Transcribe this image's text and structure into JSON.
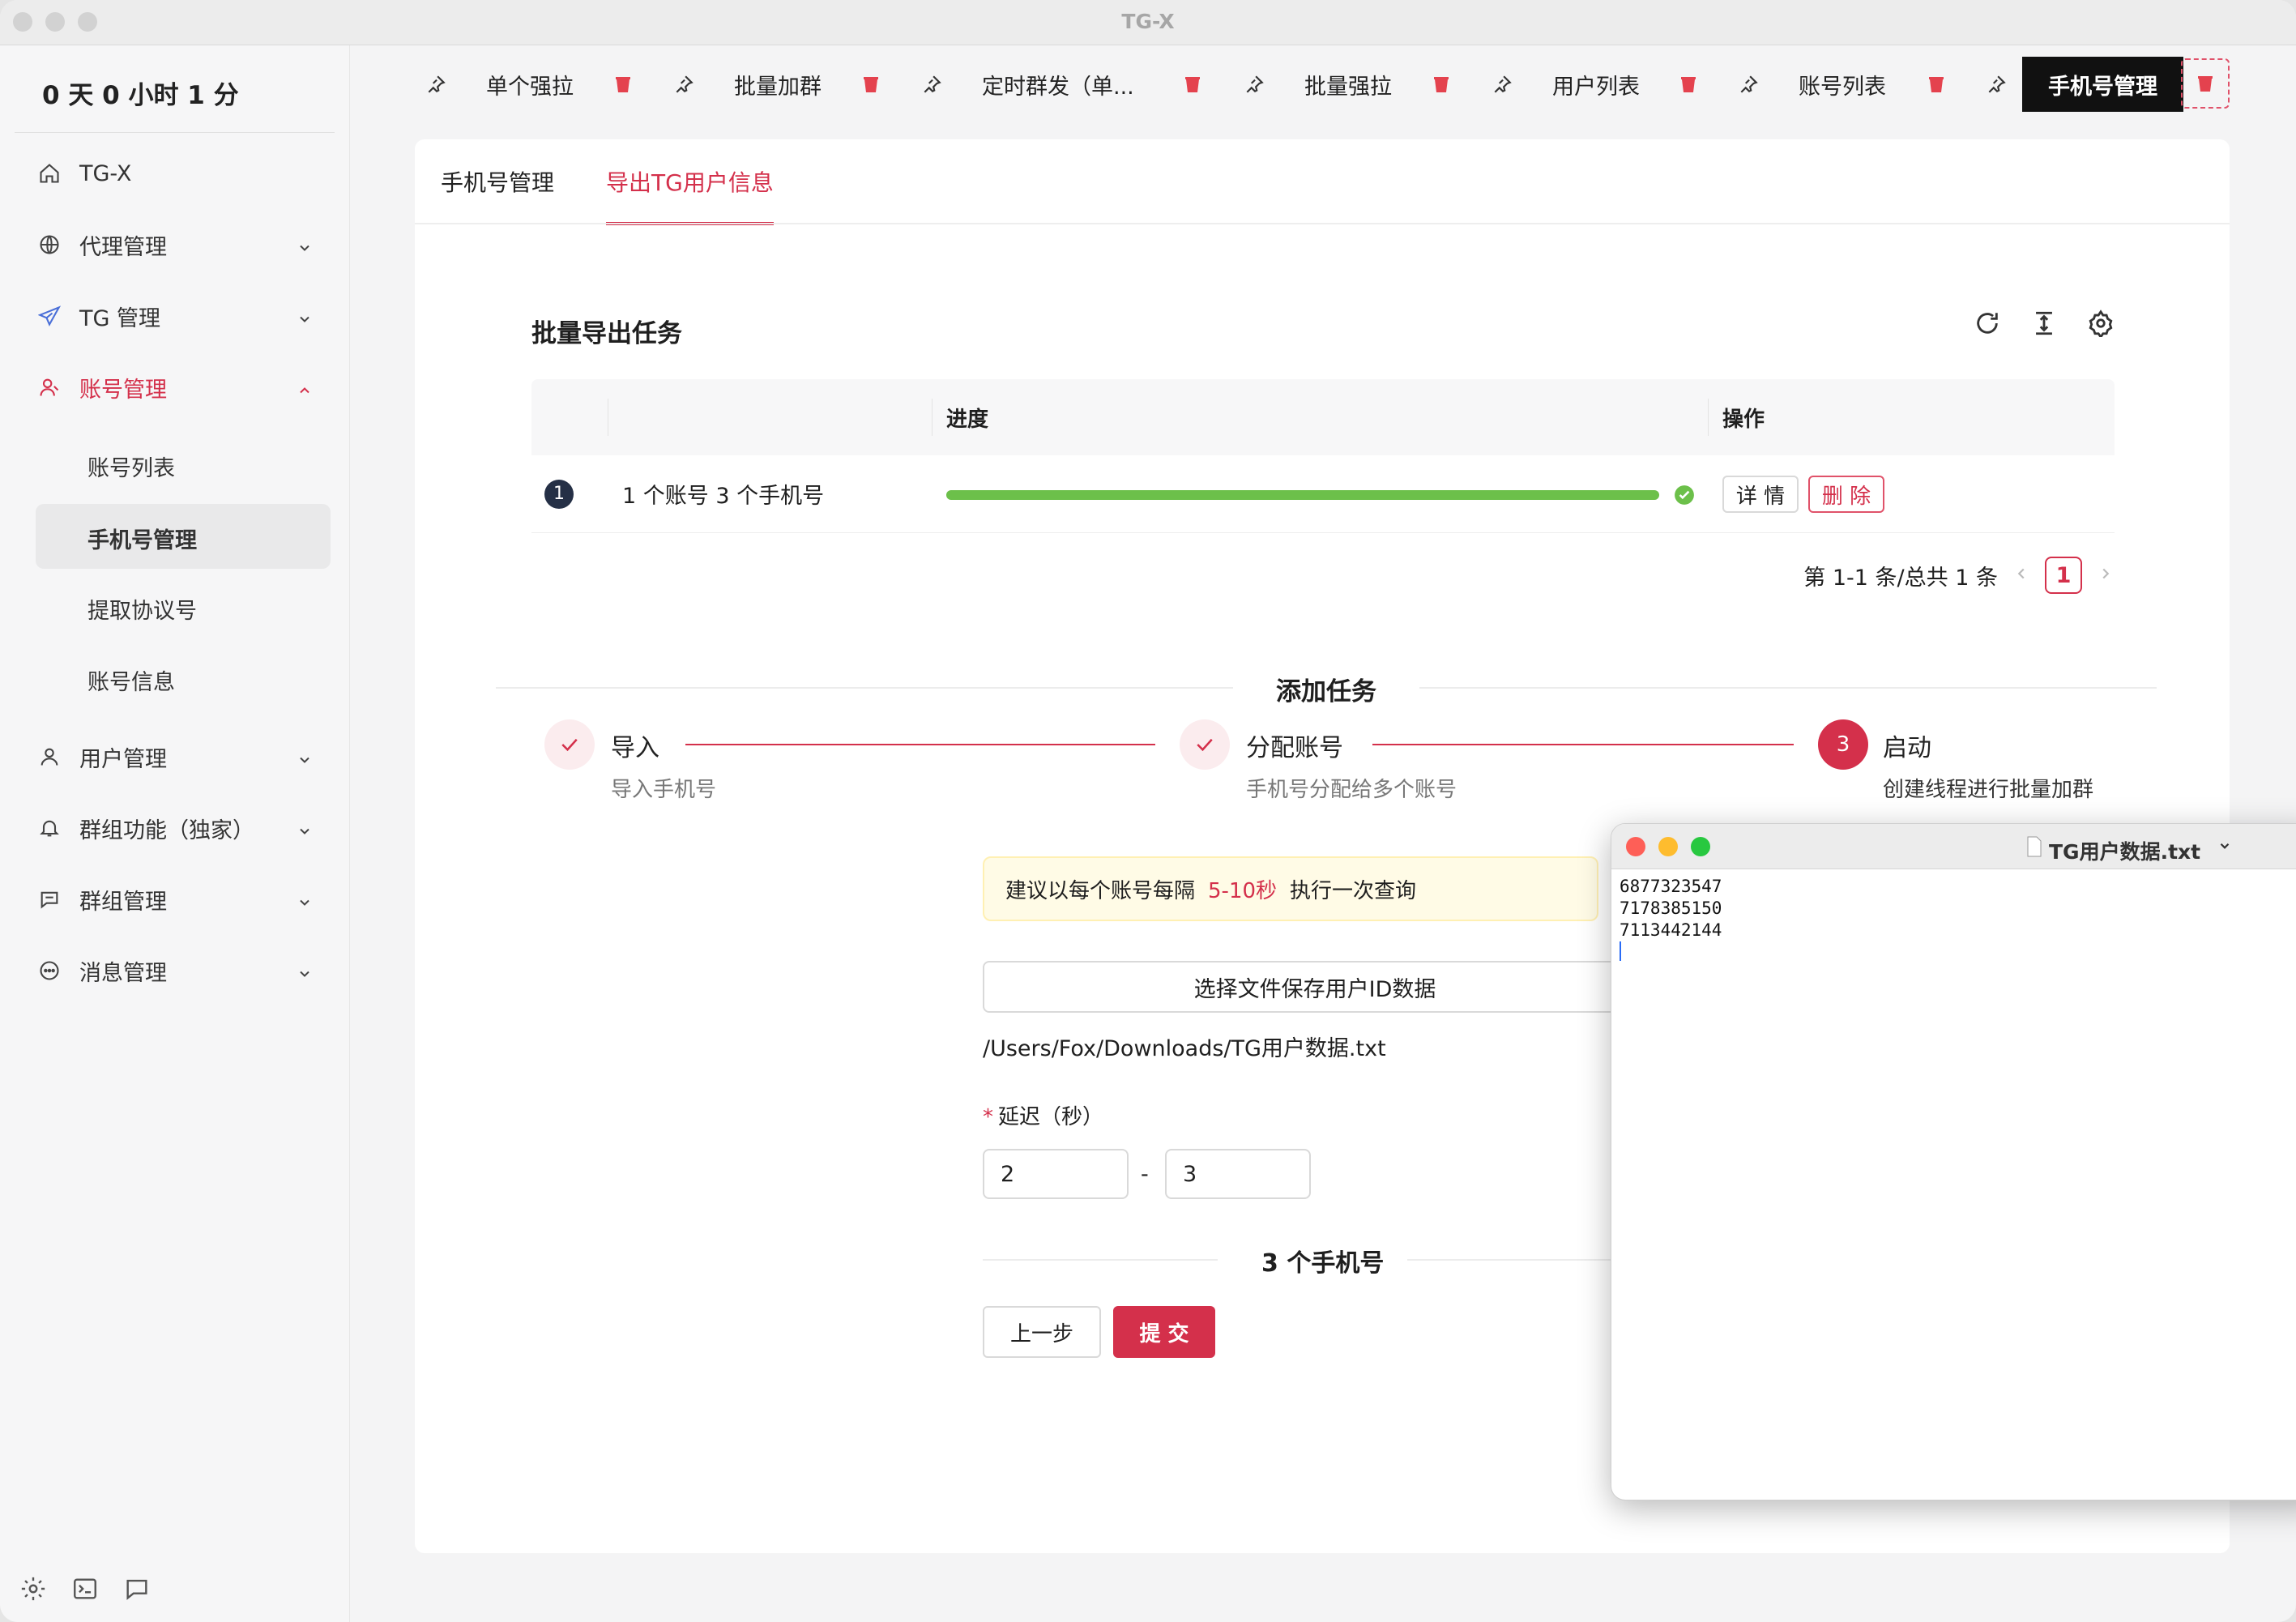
{
  "window": {
    "title": "TG-X"
  },
  "sidebar": {
    "timer": "0 天 0 小时 1 分",
    "items": [
      {
        "label": "TG-X",
        "icon": "home-icon"
      },
      {
        "label": "代理管理",
        "icon": "globe-icon"
      },
      {
        "label": "TG 管理",
        "icon": "send-icon"
      },
      {
        "label": "账号管理",
        "icon": "user-icon"
      },
      {
        "label": "用户管理",
        "icon": "user-icon"
      },
      {
        "label": "群组功能（独家）",
        "icon": "bell-icon"
      },
      {
        "label": "群组管理",
        "icon": "chat-icon"
      },
      {
        "label": "消息管理",
        "icon": "message-icon"
      }
    ],
    "subitems": [
      "账号列表",
      "手机号管理",
      "提取协议号",
      "账号信息"
    ]
  },
  "tabs": [
    "单个强拉",
    "批量加群",
    "定时群发（单...",
    "批量强拉",
    "用户列表",
    "账号列表",
    "手机号管理"
  ],
  "page": {
    "tabs": [
      "手机号管理",
      "导出TG用户信息"
    ],
    "section_title": "批量导出任务",
    "table": {
      "headers": [
        "进度",
        "操作"
      ],
      "row": {
        "index": "1",
        "text": "1 个账号 3 个手机号",
        "progress": 1.0,
        "detail_label": "详 情",
        "delete_label": "删 除"
      }
    },
    "pager": {
      "summary": "第 1-1 条/总共 1 条",
      "page": "1"
    },
    "add_task": {
      "title": "添加任务",
      "steps": [
        {
          "title": "导入",
          "desc": "导入手机号"
        },
        {
          "title": "分配账号",
          "desc": "手机号分配给多个账号"
        },
        {
          "num": "3",
          "title": "启动",
          "desc": "创建线程进行批量加群"
        }
      ],
      "alert_pre": "建议以每个账号每隔",
      "alert_hl": "5-10秒",
      "alert_post": "执行一次查询",
      "file_button": "选择文件保存用户ID数据",
      "file_path": "/Users/Fox/Downloads/TG用户数据.txt",
      "delay_label": "延迟（秒）",
      "delay_min": "2",
      "delay_sep": "-",
      "delay_max": "3",
      "count_text": "3 个手机号",
      "prev_button": "上一步",
      "submit_button": "提 交"
    }
  },
  "notepad": {
    "title": "TG用户数据.txt",
    "lines": [
      "6877323547",
      "7178385150",
      "7113442144"
    ]
  },
  "colors": {
    "accent": "#d4304b",
    "success": "#6cc04a",
    "dark": "#111111"
  }
}
